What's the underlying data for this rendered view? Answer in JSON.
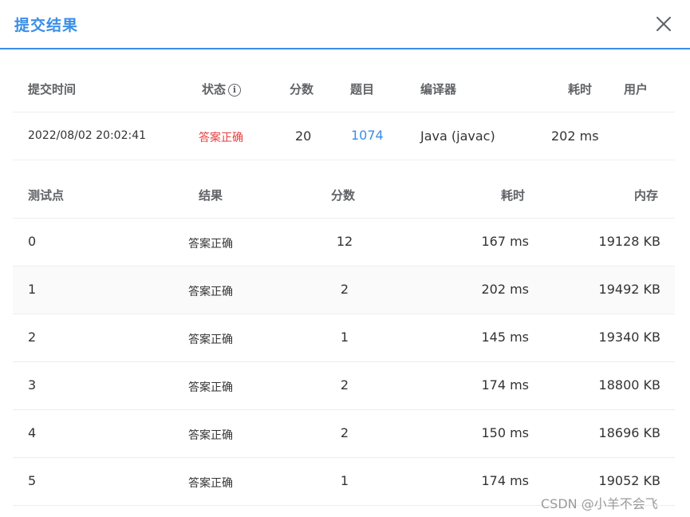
{
  "dialog": {
    "title": "提交结果",
    "close_label": "×"
  },
  "summary": {
    "headers": {
      "time": "提交时间",
      "status": "状态",
      "score": "分数",
      "problem": "题目",
      "compiler": "编译器",
      "duration": "耗时",
      "user": "用户"
    },
    "status_info_icon": "i",
    "row": {
      "time": "2022/08/02 20:02:41",
      "status": "答案正确",
      "score": "20",
      "problem": "1074",
      "compiler": "Java (javac)",
      "duration": "202 ms",
      "user": ""
    }
  },
  "cases": {
    "headers": {
      "id": "测试点",
      "result": "结果",
      "score": "分数",
      "time": "耗时",
      "memory": "内存"
    },
    "rows": [
      {
        "id": "0",
        "result": "答案正确",
        "score": "12",
        "time": "167 ms",
        "memory": "19128 KB"
      },
      {
        "id": "1",
        "result": "答案正确",
        "score": "2",
        "time": "202 ms",
        "memory": "19492 KB"
      },
      {
        "id": "2",
        "result": "答案正确",
        "score": "1",
        "time": "145 ms",
        "memory": "19340 KB"
      },
      {
        "id": "3",
        "result": "答案正确",
        "score": "2",
        "time": "174 ms",
        "memory": "18800 KB"
      },
      {
        "id": "4",
        "result": "答案正确",
        "score": "2",
        "time": "150 ms",
        "memory": "18696 KB"
      },
      {
        "id": "5",
        "result": "答案正确",
        "score": "1",
        "time": "174 ms",
        "memory": "19052 KB"
      }
    ]
  },
  "watermark": "CSDN @小羊不会飞",
  "colors": {
    "accent": "#3a8ee6",
    "accepted": "#e63e3e",
    "stripe": "#fafafa",
    "border": "#ebeef5"
  },
  "icons": {
    "close": "close-icon",
    "info": "info-icon"
  }
}
